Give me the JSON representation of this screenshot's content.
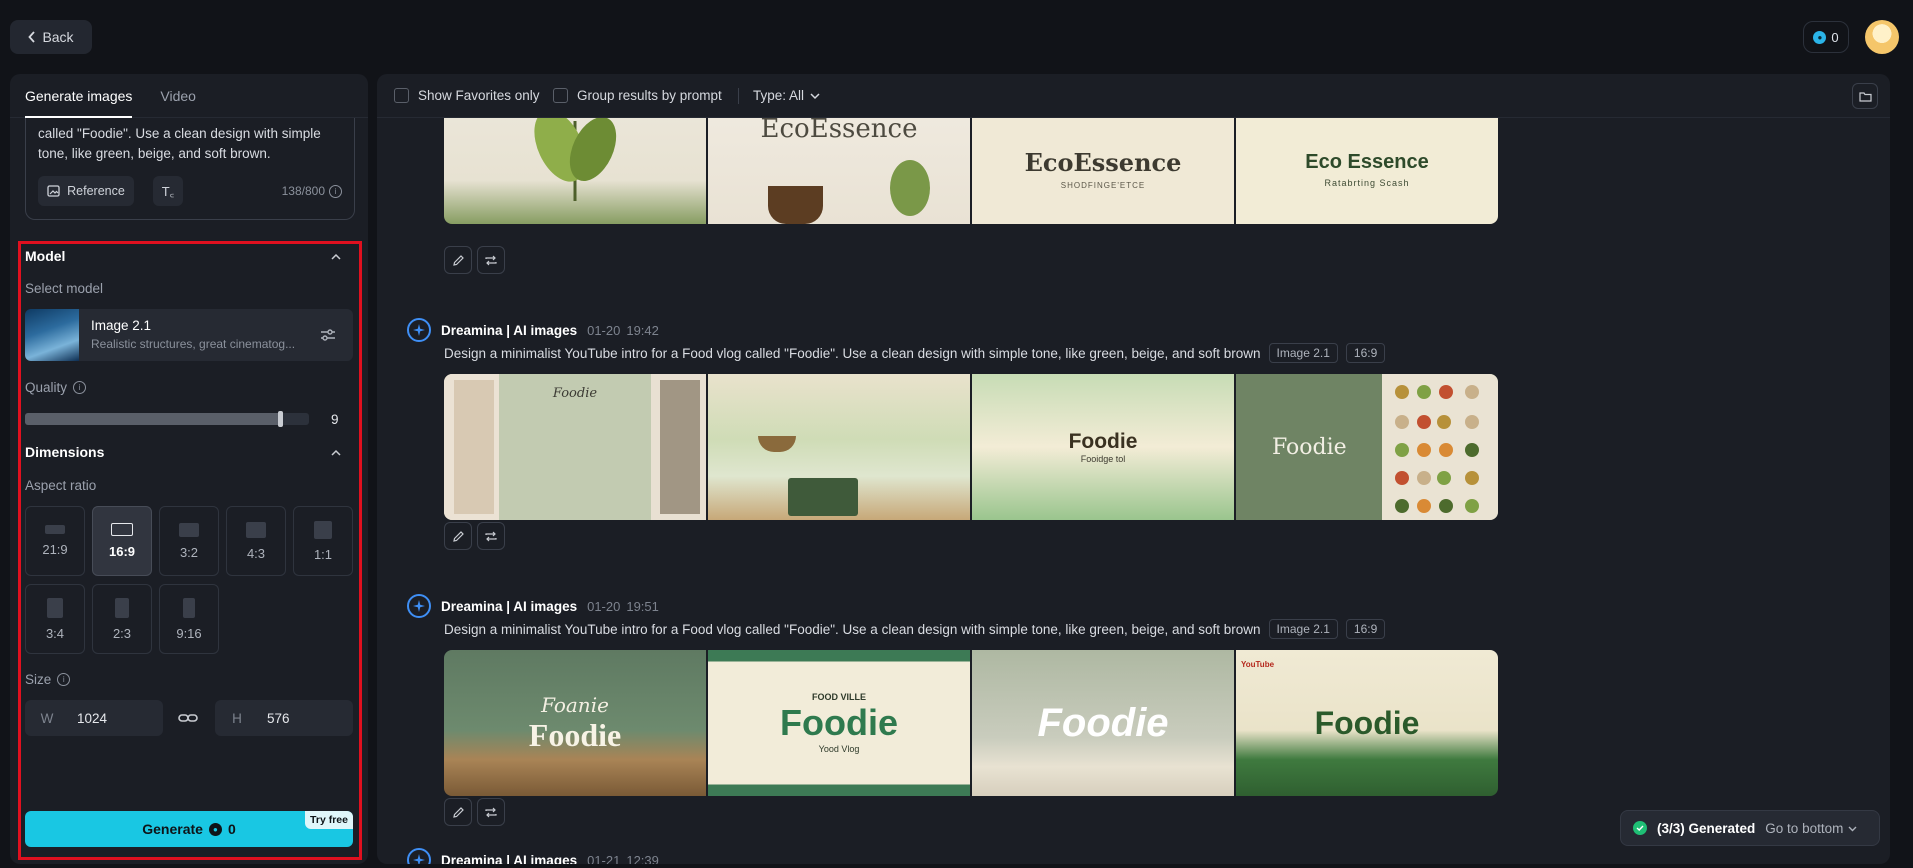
{
  "header": {
    "back_label": "Back",
    "credits": "0",
    "avatar_icon": "user-avatar"
  },
  "left": {
    "tabs": [
      {
        "label": "Generate images",
        "active": true
      },
      {
        "label": "Video",
        "active": false
      }
    ],
    "prompt": {
      "text": "called \"Foodie\". Use a clean design with simple tone, like green, beige, and soft brown.",
      "reference_label": "Reference",
      "char_count": "138/800"
    },
    "model_section": {
      "title": "Model",
      "select_label": "Select model",
      "model_name": "Image 2.1",
      "model_desc": "Realistic structures, great cinematog..."
    },
    "quality": {
      "label": "Quality",
      "value": "9",
      "fraction": 0.9
    },
    "dimensions": {
      "title": "Dimensions",
      "aspect_label": "Aspect ratio",
      "ratios": [
        {
          "label": "21:9",
          "selected": false
        },
        {
          "label": "16:9",
          "selected": true
        },
        {
          "label": "3:2",
          "selected": false
        },
        {
          "label": "4:3",
          "selected": false
        },
        {
          "label": "1:1",
          "selected": false
        },
        {
          "label": "3:4",
          "selected": false
        },
        {
          "label": "2:3",
          "selected": false
        },
        {
          "label": "9:16",
          "selected": false
        }
      ],
      "size_label": "Size",
      "width_prefix": "W",
      "width_value": "1024",
      "height_prefix": "H",
      "height_value": "576"
    },
    "generate": {
      "label": "Generate",
      "cost": "0",
      "badge": "Try free"
    }
  },
  "main": {
    "filters": {
      "favorites_label": "Show Favorites only",
      "group_label": "Group results by prompt",
      "type_label": "Type: All"
    },
    "top_row_texts": [
      "",
      "EcoEssence",
      "EcoEssence",
      "Eco Essence"
    ],
    "top_row_subtexts": [
      "",
      "",
      "SHODFINGE'ETCE",
      "Ratabrting Scash"
    ],
    "generations": [
      {
        "author": "Dreamina | AI images",
        "date": "01-20",
        "time": "19:42",
        "prompt": "Design a minimalist YouTube intro for a Food vlog called \"Foodie\". Use a clean design with simple tone, like green, beige, and soft brown",
        "model_tag": "Image 2.1",
        "ratio_tag": "16:9",
        "tile_texts": [
          "Foodie",
          "",
          "Foodie",
          "Foodie"
        ],
        "tile_subtexts": [
          "",
          "",
          "Fooidge tol",
          ""
        ]
      },
      {
        "author": "Dreamina | AI images",
        "date": "01-20",
        "time": "19:51",
        "prompt": "Design a minimalist YouTube intro for a Food vlog called \"Foodie\". Use a clean design with simple tone, like green, beige, and soft brown",
        "model_tag": "Image 2.1",
        "ratio_tag": "16:9",
        "tile_texts": [
          "Foodie",
          "Foodie",
          "Foodie",
          "Foodie"
        ],
        "tile_subtexts": [
          "Foanie",
          "FOOD VILLE",
          "",
          "YouTube"
        ],
        "tile_subtexts2": [
          "",
          "Yood Vlog",
          "",
          ""
        ]
      },
      {
        "author": "Dreamina | AI images",
        "date": "01-21",
        "time": "12:39"
      }
    ],
    "toast": {
      "status": "(3/3) Generated",
      "link": "Go to bottom"
    }
  },
  "colors": {
    "accent": "#19c7e3",
    "highlight": "#e0101f",
    "success": "#1fbf75"
  }
}
